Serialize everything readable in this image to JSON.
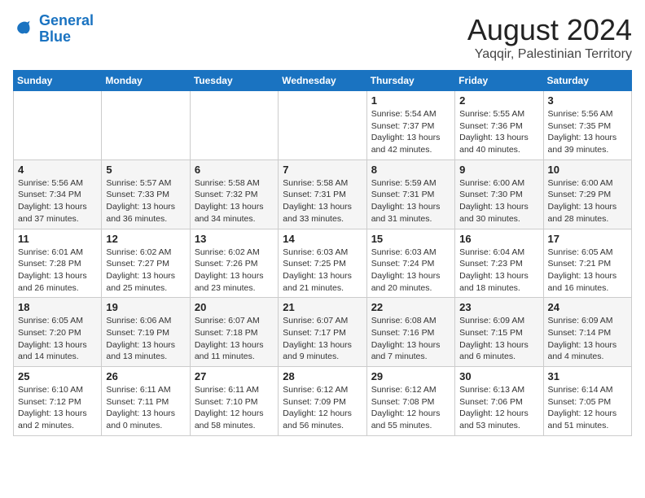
{
  "logo": {
    "text_general": "General",
    "text_blue": "Blue"
  },
  "header": {
    "month_year": "August 2024",
    "location": "Yaqqir, Palestinian Territory"
  },
  "weekdays": [
    "Sunday",
    "Monday",
    "Tuesday",
    "Wednesday",
    "Thursday",
    "Friday",
    "Saturday"
  ],
  "weeks": [
    [
      {
        "day": "",
        "info": ""
      },
      {
        "day": "",
        "info": ""
      },
      {
        "day": "",
        "info": ""
      },
      {
        "day": "",
        "info": ""
      },
      {
        "day": "1",
        "info": "Sunrise: 5:54 AM\nSunset: 7:37 PM\nDaylight: 13 hours\nand 42 minutes."
      },
      {
        "day": "2",
        "info": "Sunrise: 5:55 AM\nSunset: 7:36 PM\nDaylight: 13 hours\nand 40 minutes."
      },
      {
        "day": "3",
        "info": "Sunrise: 5:56 AM\nSunset: 7:35 PM\nDaylight: 13 hours\nand 39 minutes."
      }
    ],
    [
      {
        "day": "4",
        "info": "Sunrise: 5:56 AM\nSunset: 7:34 PM\nDaylight: 13 hours\nand 37 minutes."
      },
      {
        "day": "5",
        "info": "Sunrise: 5:57 AM\nSunset: 7:33 PM\nDaylight: 13 hours\nand 36 minutes."
      },
      {
        "day": "6",
        "info": "Sunrise: 5:58 AM\nSunset: 7:32 PM\nDaylight: 13 hours\nand 34 minutes."
      },
      {
        "day": "7",
        "info": "Sunrise: 5:58 AM\nSunset: 7:31 PM\nDaylight: 13 hours\nand 33 minutes."
      },
      {
        "day": "8",
        "info": "Sunrise: 5:59 AM\nSunset: 7:31 PM\nDaylight: 13 hours\nand 31 minutes."
      },
      {
        "day": "9",
        "info": "Sunrise: 6:00 AM\nSunset: 7:30 PM\nDaylight: 13 hours\nand 30 minutes."
      },
      {
        "day": "10",
        "info": "Sunrise: 6:00 AM\nSunset: 7:29 PM\nDaylight: 13 hours\nand 28 minutes."
      }
    ],
    [
      {
        "day": "11",
        "info": "Sunrise: 6:01 AM\nSunset: 7:28 PM\nDaylight: 13 hours\nand 26 minutes."
      },
      {
        "day": "12",
        "info": "Sunrise: 6:02 AM\nSunset: 7:27 PM\nDaylight: 13 hours\nand 25 minutes."
      },
      {
        "day": "13",
        "info": "Sunrise: 6:02 AM\nSunset: 7:26 PM\nDaylight: 13 hours\nand 23 minutes."
      },
      {
        "day": "14",
        "info": "Sunrise: 6:03 AM\nSunset: 7:25 PM\nDaylight: 13 hours\nand 21 minutes."
      },
      {
        "day": "15",
        "info": "Sunrise: 6:03 AM\nSunset: 7:24 PM\nDaylight: 13 hours\nand 20 minutes."
      },
      {
        "day": "16",
        "info": "Sunrise: 6:04 AM\nSunset: 7:23 PM\nDaylight: 13 hours\nand 18 minutes."
      },
      {
        "day": "17",
        "info": "Sunrise: 6:05 AM\nSunset: 7:21 PM\nDaylight: 13 hours\nand 16 minutes."
      }
    ],
    [
      {
        "day": "18",
        "info": "Sunrise: 6:05 AM\nSunset: 7:20 PM\nDaylight: 13 hours\nand 14 minutes."
      },
      {
        "day": "19",
        "info": "Sunrise: 6:06 AM\nSunset: 7:19 PM\nDaylight: 13 hours\nand 13 minutes."
      },
      {
        "day": "20",
        "info": "Sunrise: 6:07 AM\nSunset: 7:18 PM\nDaylight: 13 hours\nand 11 minutes."
      },
      {
        "day": "21",
        "info": "Sunrise: 6:07 AM\nSunset: 7:17 PM\nDaylight: 13 hours\nand 9 minutes."
      },
      {
        "day": "22",
        "info": "Sunrise: 6:08 AM\nSunset: 7:16 PM\nDaylight: 13 hours\nand 7 minutes."
      },
      {
        "day": "23",
        "info": "Sunrise: 6:09 AM\nSunset: 7:15 PM\nDaylight: 13 hours\nand 6 minutes."
      },
      {
        "day": "24",
        "info": "Sunrise: 6:09 AM\nSunset: 7:14 PM\nDaylight: 13 hours\nand 4 minutes."
      }
    ],
    [
      {
        "day": "25",
        "info": "Sunrise: 6:10 AM\nSunset: 7:12 PM\nDaylight: 13 hours\nand 2 minutes."
      },
      {
        "day": "26",
        "info": "Sunrise: 6:11 AM\nSunset: 7:11 PM\nDaylight: 13 hours\nand 0 minutes."
      },
      {
        "day": "27",
        "info": "Sunrise: 6:11 AM\nSunset: 7:10 PM\nDaylight: 12 hours\nand 58 minutes."
      },
      {
        "day": "28",
        "info": "Sunrise: 6:12 AM\nSunset: 7:09 PM\nDaylight: 12 hours\nand 56 minutes."
      },
      {
        "day": "29",
        "info": "Sunrise: 6:12 AM\nSunset: 7:08 PM\nDaylight: 12 hours\nand 55 minutes."
      },
      {
        "day": "30",
        "info": "Sunrise: 6:13 AM\nSunset: 7:06 PM\nDaylight: 12 hours\nand 53 minutes."
      },
      {
        "day": "31",
        "info": "Sunrise: 6:14 AM\nSunset: 7:05 PM\nDaylight: 12 hours\nand 51 minutes."
      }
    ]
  ]
}
